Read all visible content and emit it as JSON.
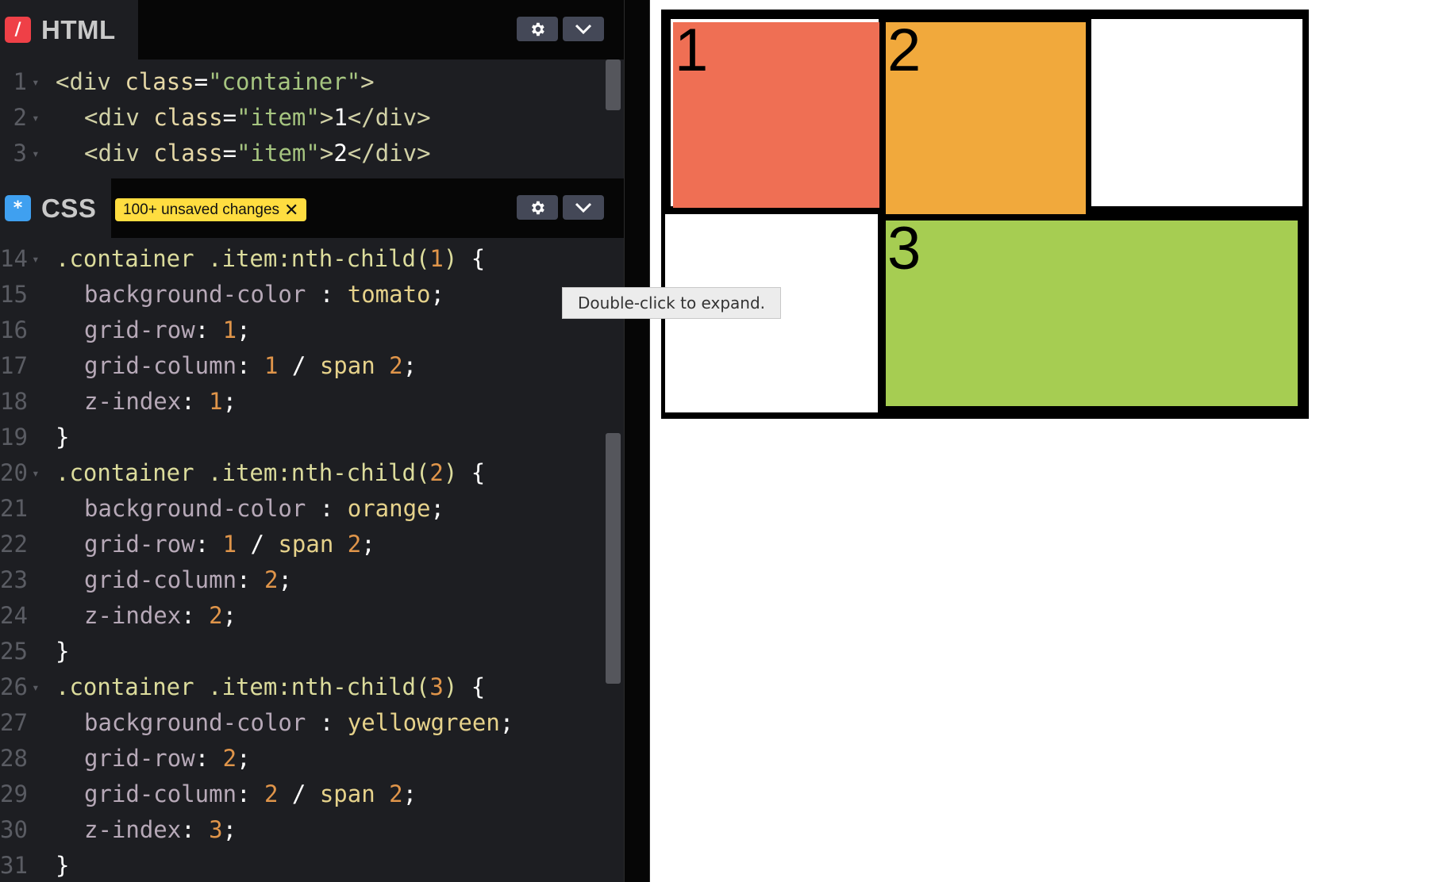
{
  "html_panel": {
    "tab_label": "HTML",
    "badge_glyph": "/",
    "badge_color": "#ef4047",
    "lines": [
      {
        "n": "1",
        "html": "<span class=\"t-tag\">&lt;div </span><span class=\"t-attr\">class</span><span class=\"t-plain\">=</span><span class=\"t-str\">\"container\"</span><span class=\"t-tag\">&gt;</span>"
      },
      {
        "n": "2",
        "html": "<span class=\"ind\"></span><span class=\"t-tag\">&lt;div </span><span class=\"t-attr\">class</span><span class=\"t-plain\">=</span><span class=\"t-str\">\"item\"</span><span class=\"t-tag\">&gt;</span><span class=\"t-plain\">1</span><span class=\"t-tag\">&lt;/div&gt;</span>"
      },
      {
        "n": "3",
        "html": "<span class=\"ind\"></span><span class=\"t-tag\">&lt;div </span><span class=\"t-attr\">class</span><span class=\"t-plain\">=</span><span class=\"t-str\">\"item\"</span><span class=\"t-tag\">&gt;</span><span class=\"t-plain\">2</span><span class=\"t-tag\">&lt;/div&gt;</span>"
      }
    ]
  },
  "css_panel": {
    "tab_label": "CSS",
    "badge_glyph": "*",
    "badge_color": "#3fa0f0",
    "unsaved_label": "100+ unsaved changes",
    "unsaved_close": "✕",
    "lines": [
      {
        "n": "14",
        "fold": true,
        "html": "<span class=\"t-sel\">.container .item:nth-child(</span><span class=\"t-num\">1</span><span class=\"t-sel\">)</span><span class=\"t-plain\"> {</span>"
      },
      {
        "n": "15",
        "html": "<span class=\"ind\"></span><span class=\"t-prop\">background-color </span><span class=\"t-plain\">: </span><span class=\"t-val\">tomato</span><span class=\"t-plain\">;</span>"
      },
      {
        "n": "16",
        "html": "<span class=\"ind\"></span><span class=\"t-prop\">grid-row</span><span class=\"t-plain\">: </span><span class=\"t-num\">1</span><span class=\"t-plain\">;</span>"
      },
      {
        "n": "17",
        "html": "<span class=\"ind\"></span><span class=\"t-prop\">grid-column</span><span class=\"t-plain\">: </span><span class=\"t-num\">1</span><span class=\"t-plain\"> / </span><span class=\"t-val\">span </span><span class=\"t-num\">2</span><span class=\"t-plain\">;</span>"
      },
      {
        "n": "18",
        "html": "<span class=\"ind\"></span><span class=\"t-prop\">z-index</span><span class=\"t-plain\">: </span><span class=\"t-num\">1</span><span class=\"t-plain\">;</span>"
      },
      {
        "n": "19",
        "html": "<span class=\"t-plain\">}</span>"
      },
      {
        "n": "20",
        "fold": true,
        "html": "<span class=\"t-sel\">.container .item:nth-child(</span><span class=\"t-num\">2</span><span class=\"t-sel\">)</span><span class=\"t-plain\"> {</span>"
      },
      {
        "n": "21",
        "html": "<span class=\"ind\"></span><span class=\"t-prop\">background-color </span><span class=\"t-plain\">: </span><span class=\"t-val\">orange</span><span class=\"t-plain\">;</span>"
      },
      {
        "n": "22",
        "html": "<span class=\"ind\"></span><span class=\"t-prop\">grid-row</span><span class=\"t-plain\">: </span><span class=\"t-num\">1</span><span class=\"t-plain\"> / </span><span class=\"t-val\">span </span><span class=\"t-num\">2</span><span class=\"t-plain\">;</span>"
      },
      {
        "n": "23",
        "html": "<span class=\"ind\"></span><span class=\"t-prop\">grid-column</span><span class=\"t-plain\">: </span><span class=\"t-num\">2</span><span class=\"t-plain\">;</span>"
      },
      {
        "n": "24",
        "html": "<span class=\"ind\"></span><span class=\"t-prop\">z-index</span><span class=\"t-plain\">: </span><span class=\"t-num\">2</span><span class=\"t-plain\">;</span>"
      },
      {
        "n": "25",
        "html": "<span class=\"t-plain\">}</span>"
      },
      {
        "n": "26",
        "fold": true,
        "html": "<span class=\"t-sel\">.container .item:nth-child(</span><span class=\"t-num\">3</span><span class=\"t-sel\">)</span><span class=\"t-plain\"> {</span>"
      },
      {
        "n": "27",
        "html": "<span class=\"ind\"></span><span class=\"t-prop\">background-color </span><span class=\"t-plain\">: </span><span class=\"t-val\">yellowgreen</span><span class=\"t-plain\">;</span>"
      },
      {
        "n": "28",
        "html": "<span class=\"ind\"></span><span class=\"t-prop\">grid-row</span><span class=\"t-plain\">: </span><span class=\"t-num\">2</span><span class=\"t-plain\">;</span>"
      },
      {
        "n": "29",
        "html": "<span class=\"ind\"></span><span class=\"t-prop\">grid-column</span><span class=\"t-plain\">: </span><span class=\"t-num\">2</span><span class=\"t-plain\"> / </span><span class=\"t-val\">span </span><span class=\"t-num\">2</span><span class=\"t-plain\">;</span>"
      },
      {
        "n": "30",
        "html": "<span class=\"ind\"></span><span class=\"t-prop\">z-index</span><span class=\"t-plain\">: </span><span class=\"t-num\">3</span><span class=\"t-plain\">;</span>"
      },
      {
        "n": "31",
        "html": "<span class=\"t-plain\">}</span>"
      }
    ]
  },
  "tooltip": "Double-click to expand.",
  "preview": {
    "items": [
      {
        "label": "1",
        "color": "#ef6f54"
      },
      {
        "label": "2",
        "color": "#f1a93c"
      },
      {
        "label": "3",
        "color": "#a6cd52"
      }
    ]
  },
  "icons": {
    "settings": "gear-icon",
    "collapse": "chevron-down-icon"
  }
}
